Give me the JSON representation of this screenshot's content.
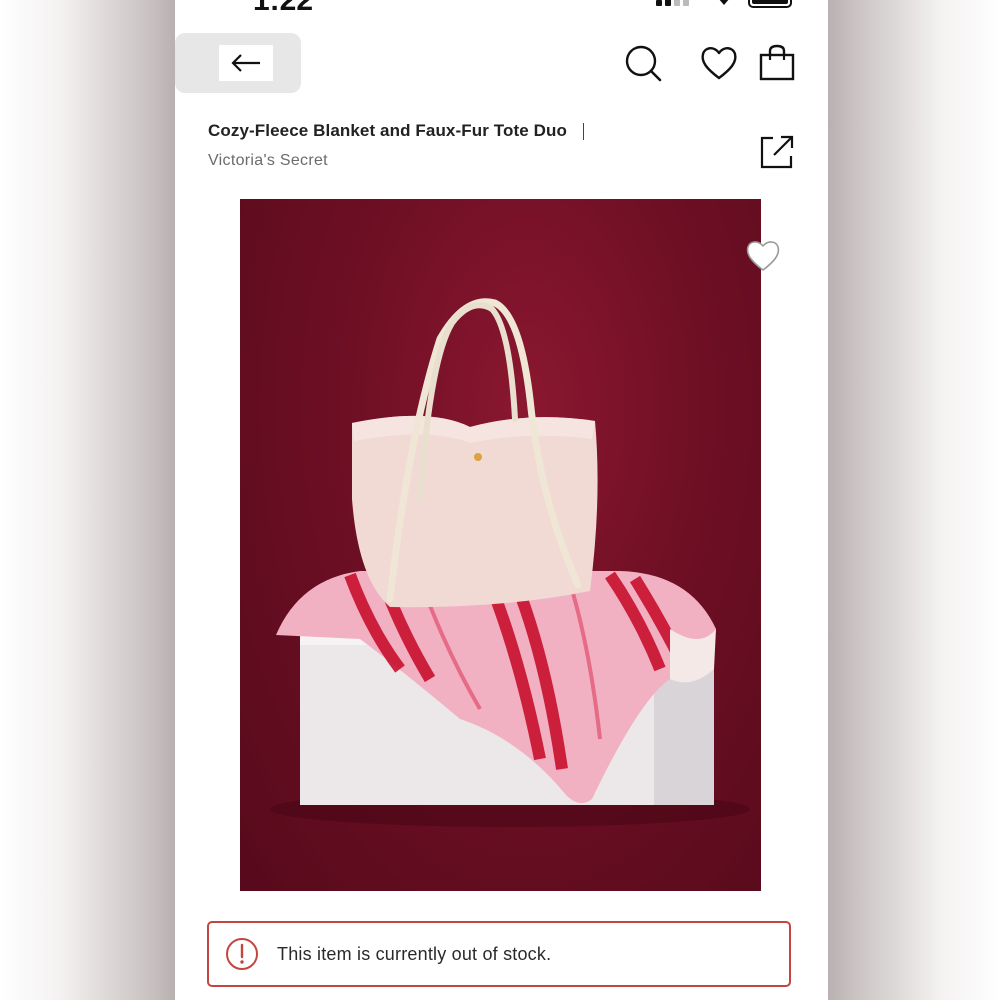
{
  "status_bar": {
    "time": "1:22"
  },
  "header": {
    "back_icon": "arrow-left-icon",
    "search_icon": "search-icon",
    "wishlist_icon": "heart-outline-icon",
    "bag_icon": "shopping-bag-icon"
  },
  "product": {
    "title": "Cozy-Fleece Blanket and Faux-Fur Tote Duo",
    "brand": "Victoria's Secret",
    "share_icon": "share-icon",
    "image_alt": "faux-fur tote on fleece blanket",
    "image_favorite_icon": "heart-outline-icon"
  },
  "stock_notice": {
    "icon": "alert-circle-icon",
    "message": "This item is currently out of stock.",
    "accent_color": "#c2463f"
  }
}
